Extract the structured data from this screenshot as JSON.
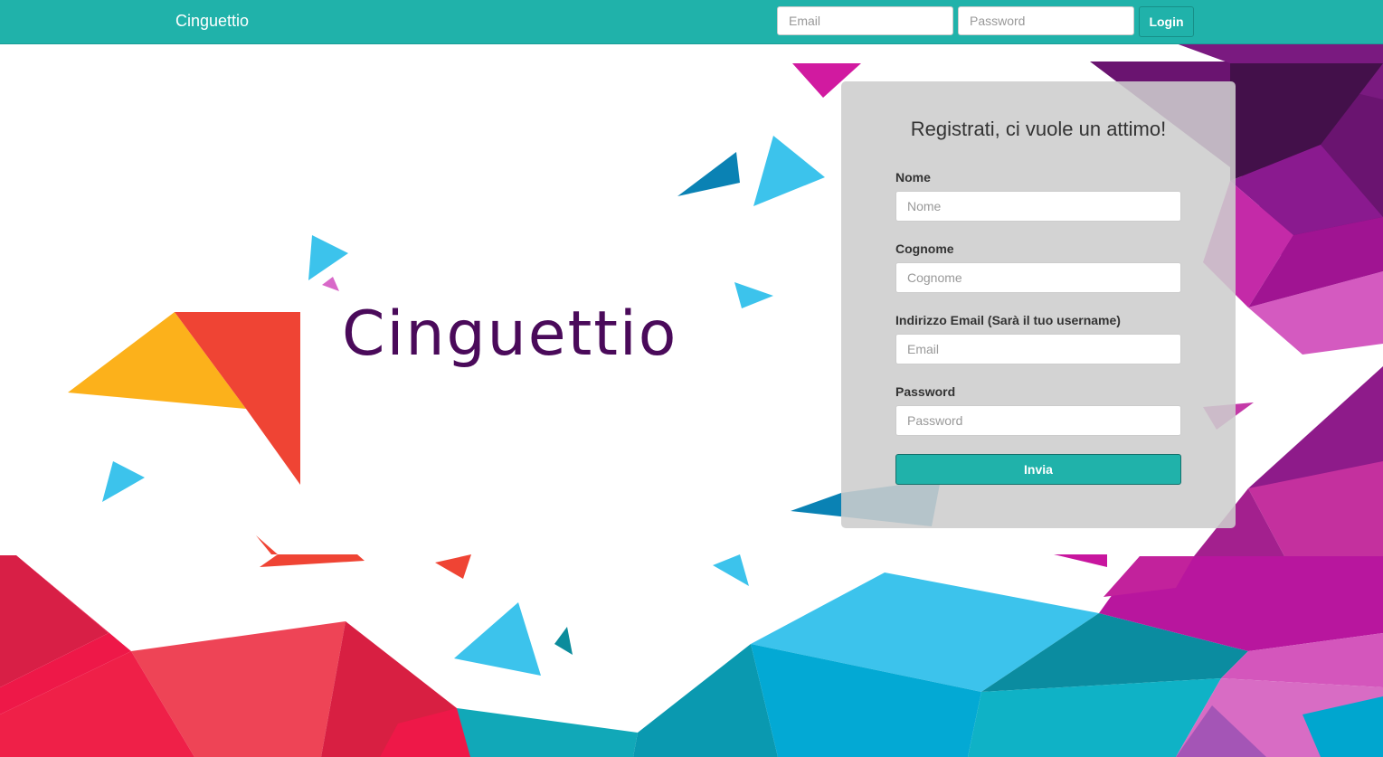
{
  "navbar": {
    "brand": "Cinguettio",
    "email_placeholder": "Email",
    "password_placeholder": "Password",
    "login_label": "Login"
  },
  "hero": {
    "title": "Cinguettio"
  },
  "signup": {
    "title": "Registrati, ci vuole un attimo!",
    "fields": [
      {
        "label": "Nome",
        "placeholder": "Nome"
      },
      {
        "label": "Cognome",
        "placeholder": "Cognome"
      },
      {
        "label": "Indirizzo Email (Sarà il tuo username)",
        "placeholder": "Email"
      },
      {
        "label": "Password",
        "placeholder": "Password"
      }
    ],
    "submit_label": "Invia"
  },
  "colors": {
    "navbar": "#20b2aa",
    "accent": "#20b2aa",
    "hero_title": "#4a0a5a",
    "panel": "#cdcdcd"
  }
}
